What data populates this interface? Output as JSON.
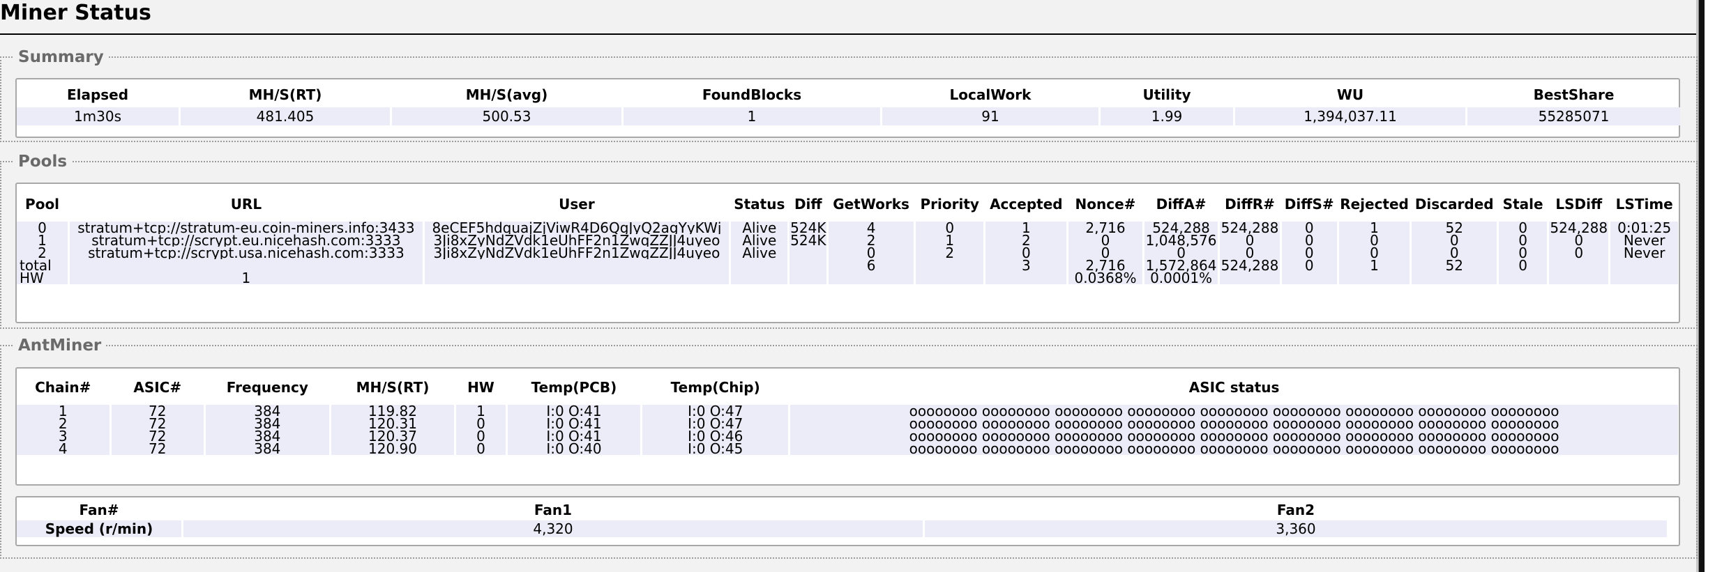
{
  "page": {
    "title": "Miner Status"
  },
  "summary": {
    "legend": "Summary",
    "columns": [
      "Elapsed",
      "MH/S(RT)",
      "MH/S(avg)",
      "FoundBlocks",
      "LocalWork",
      "Utility",
      "WU",
      "BestShare"
    ],
    "rows": [
      [
        "1m30s",
        "481.405",
        "500.53",
        "1",
        "91",
        "1.99",
        "1,394,037.11",
        "55285071"
      ]
    ]
  },
  "pools": {
    "legend": "Pools",
    "columns": [
      "Pool",
      "URL",
      "User",
      "Status",
      "Diff",
      "GetWorks",
      "Priority",
      "Accepted",
      "Nonce#",
      "DiffA#",
      "DiffR#",
      "DiffS#",
      "Rejected",
      "Discarded",
      "Stale",
      "LSDiff",
      "LSTime"
    ],
    "rows": [
      [
        "0",
        "stratum+tcp://stratum-eu.coin-miners.info:3433",
        "8eCEF5hdquajZjViwR4D6QgJyQ2agYyKWj",
        "Alive",
        "524K",
        "4",
        "0",
        "1",
        "2,716",
        "524,288",
        "524,288",
        "0",
        "1",
        "52",
        "0",
        "524,288",
        "0:01:25"
      ],
      [
        "1",
        "stratum+tcp://scrypt.eu.nicehash.com:3333",
        "3Ji8xZyNdZVdk1eUhFF2n1ZwqZZJJ4uyeo",
        "Alive",
        "524K",
        "2",
        "1",
        "2",
        "0",
        "1,048,576",
        "0",
        "0",
        "0",
        "0",
        "0",
        "0",
        "Never"
      ],
      [
        "2",
        "stratum+tcp://scrypt.usa.nicehash.com:3333",
        "3Ji8xZyNdZVdk1eUhFF2n1ZwqZZJJ4uyeo",
        "Alive",
        "",
        "0",
        "2",
        "0",
        "0",
        "0",
        "0",
        "0",
        "0",
        "0",
        "0",
        "0",
        "Never"
      ],
      [
        "total",
        "",
        "",
        "",
        "",
        "6",
        "",
        "3",
        "2,716",
        "1,572,864",
        "524,288",
        "0",
        "1",
        "52",
        "0",
        "",
        ""
      ],
      [
        "HW",
        "1",
        "",
        "",
        "",
        "",
        "",
        "",
        "0.0368%",
        "0.0001%",
        "",
        "",
        "",
        "",
        "",
        "",
        ""
      ]
    ]
  },
  "antminer": {
    "legend": "AntMiner",
    "columns": [
      "Chain#",
      "ASIC#",
      "Frequency",
      "MH/S(RT)",
      "HW",
      "Temp(PCB)",
      "Temp(Chip)",
      "ASIC status"
    ],
    "rows": [
      [
        "1",
        "72",
        "384",
        "119.82",
        "1",
        "I:0 O:41",
        "I:0 O:47",
        "oooooooo oooooooo oooooooo oooooooo oooooooo oooooooo oooooooo oooooooo oooooooo"
      ],
      [
        "2",
        "72",
        "384",
        "120.31",
        "0",
        "I:0 O:41",
        "I:0 O:47",
        "oooooooo oooooooo oooooooo oooooooo oooooooo oooooooo oooooooo oooooooo oooooooo"
      ],
      [
        "3",
        "72",
        "384",
        "120.37",
        "0",
        "I:0 O:41",
        "I:0 O:46",
        "oooooooo oooooooo oooooooo oooooooo oooooooo oooooooo oooooooo oooooooo oooooooo"
      ],
      [
        "4",
        "72",
        "384",
        "120.90",
        "0",
        "I:0 O:40",
        "I:0 O:45",
        "oooooooo oooooooo oooooooo oooooooo oooooooo oooooooo oooooooo oooooooo oooooooo"
      ]
    ],
    "fans": {
      "columns": [
        "Fan#",
        "Fan1",
        "Fan2"
      ],
      "rows": [
        [
          "Speed (r/min)",
          "4,320",
          "3,360"
        ]
      ]
    }
  }
}
